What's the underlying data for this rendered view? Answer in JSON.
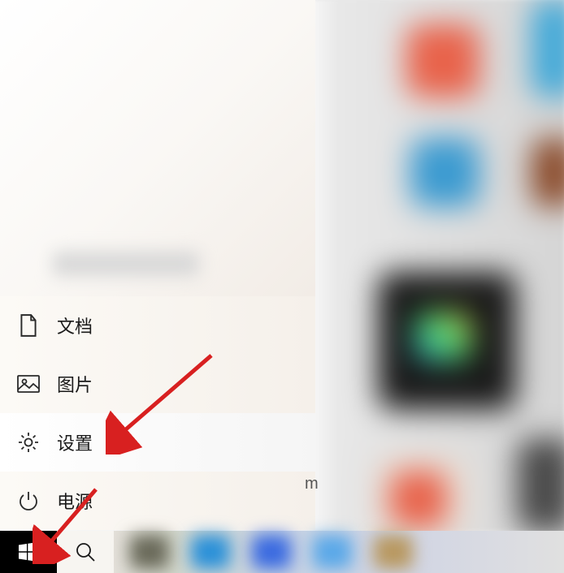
{
  "menu": {
    "documents": "文档",
    "pictures": "图片",
    "settings": "设置",
    "power": "电源"
  },
  "annotations": {
    "arrow_to": "设置",
    "arrow_to_start": "开始"
  }
}
